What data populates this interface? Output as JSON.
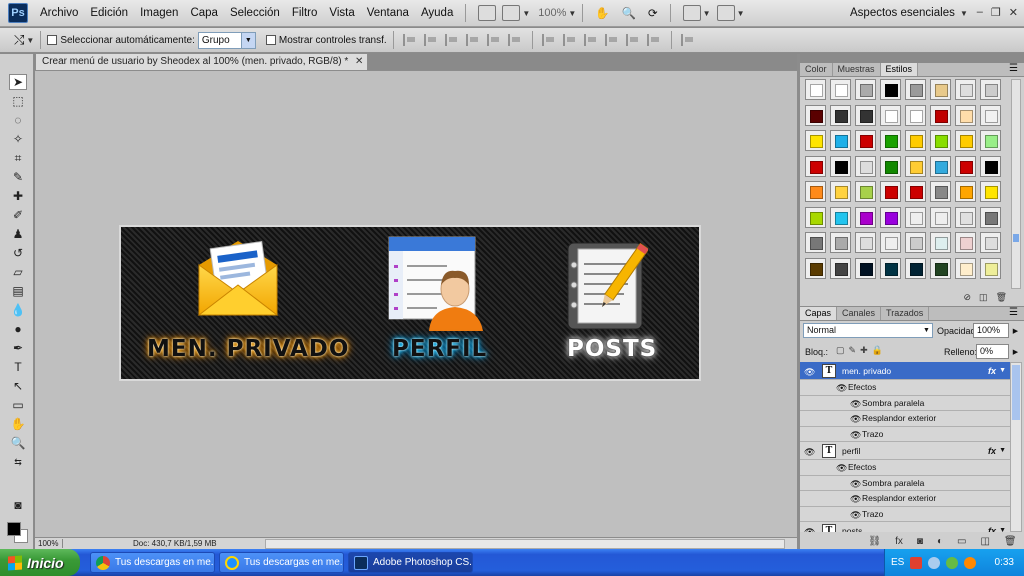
{
  "app": {
    "logo": "Ps"
  },
  "menubar": {
    "items": [
      "Archivo",
      "Edición",
      "Imagen",
      "Capa",
      "Selección",
      "Filtro",
      "Vista",
      "Ventana",
      "Ayuda"
    ],
    "zoom": "100%",
    "workspace": "Aspectos esenciales"
  },
  "options": {
    "auto_select_label": "Seleccionar automáticamente:",
    "group_value": "Grupo",
    "show_transform_label": "Mostrar controles transf."
  },
  "document": {
    "tab_title": "Crear menú de usuario by Sheodex al 100% (men. privado, RGB/8) *",
    "status_zoom": "100%",
    "status_doc": "Doc: 430,7 KB/1,59 MB"
  },
  "banner": {
    "items": [
      {
        "label": "MEN. PRIVADO",
        "glow": "#ffa800",
        "icon": "mail-envelope-icon"
      },
      {
        "label": "PERFIL",
        "glow": "#00b8ff",
        "icon": "user-profile-icon"
      },
      {
        "label": "POSTS",
        "glow": "#ffffff",
        "icon": "notepad-pencil-icon"
      }
    ]
  },
  "swatch_panel": {
    "tabs": [
      "Color",
      "Muestras",
      "Estilos"
    ],
    "active_tab": "Estilos",
    "styles": [
      "#ffffff",
      "#ffffff",
      "#aaaaaa",
      "#000000",
      "#9a9a9a",
      "#e8c98a",
      "#dddddd",
      "#cccccc",
      "#5a0000",
      "#333333",
      "#333333",
      "#ffffff",
      "#ffffff",
      "#c00000",
      "#ffddaa",
      "#f2f2f2",
      "#ffe500",
      "#1fb0e8",
      "#cc0000",
      "#1aa100",
      "#ffcc00",
      "#88dd00",
      "#ffcc00",
      "#99ee88",
      "#cc0000",
      "#000000",
      "#dddddd",
      "#118800",
      "#ffcc33",
      "#33aadd",
      "#cc0000",
      "#000000",
      "#ff8a1a",
      "#ffd23f",
      "#a7d14a",
      "#cc0000",
      "#cc0000",
      "#888888",
      "#ffa500",
      "#ffe500",
      "#a8d800",
      "#22c4ee",
      "#aa00cc",
      "#9900dd",
      "#eeeeee",
      "#eeeeee",
      "#e0e0e0",
      "#777777",
      "#777777",
      "#aaaaaa",
      "#dddddd",
      "#eeeeee",
      "#cccccc",
      "#ddeeee",
      "#eed0d0",
      "#dddddd",
      "#5a3b00",
      "#444444",
      "#001122",
      "#003344",
      "#002233",
      "#224422",
      "#ffeecc",
      "#eeee99"
    ]
  },
  "layers_panel": {
    "tabs": [
      "Capas",
      "Canales",
      "Trazados"
    ],
    "active_tab": "Capas",
    "blend_mode": "Normal",
    "opacity_label": "Opacidad:",
    "opacity": "100%",
    "lock_label": "Bloq.:",
    "fill_label": "Relleno:",
    "fill": "0%",
    "rows": [
      {
        "kind": "layer",
        "name": "men. privado",
        "selected": true
      },
      {
        "kind": "effects",
        "name": "Efectos"
      },
      {
        "kind": "effect",
        "name": "Sombra paralela"
      },
      {
        "kind": "effect",
        "name": "Resplandor exterior"
      },
      {
        "kind": "effect",
        "name": "Trazo"
      },
      {
        "kind": "layer",
        "name": "perfil",
        "selected": false
      },
      {
        "kind": "effects",
        "name": "Efectos"
      },
      {
        "kind": "effect",
        "name": "Sombra paralela"
      },
      {
        "kind": "effect",
        "name": "Resplandor exterior"
      },
      {
        "kind": "effect",
        "name": "Trazo"
      },
      {
        "kind": "layer",
        "name": "posts",
        "selected": false
      }
    ]
  },
  "taskbar": {
    "start_label": "Inicio",
    "tasks": [
      {
        "label": "Tus descargas en me...",
        "icon": "chrome-icon"
      },
      {
        "label": "Tus descargas en me...",
        "icon": "internet-explorer-icon"
      },
      {
        "label": "Adobe Photoshop CS...",
        "icon": "photoshop-icon"
      }
    ],
    "lang": "ES",
    "clock": "0:33"
  }
}
